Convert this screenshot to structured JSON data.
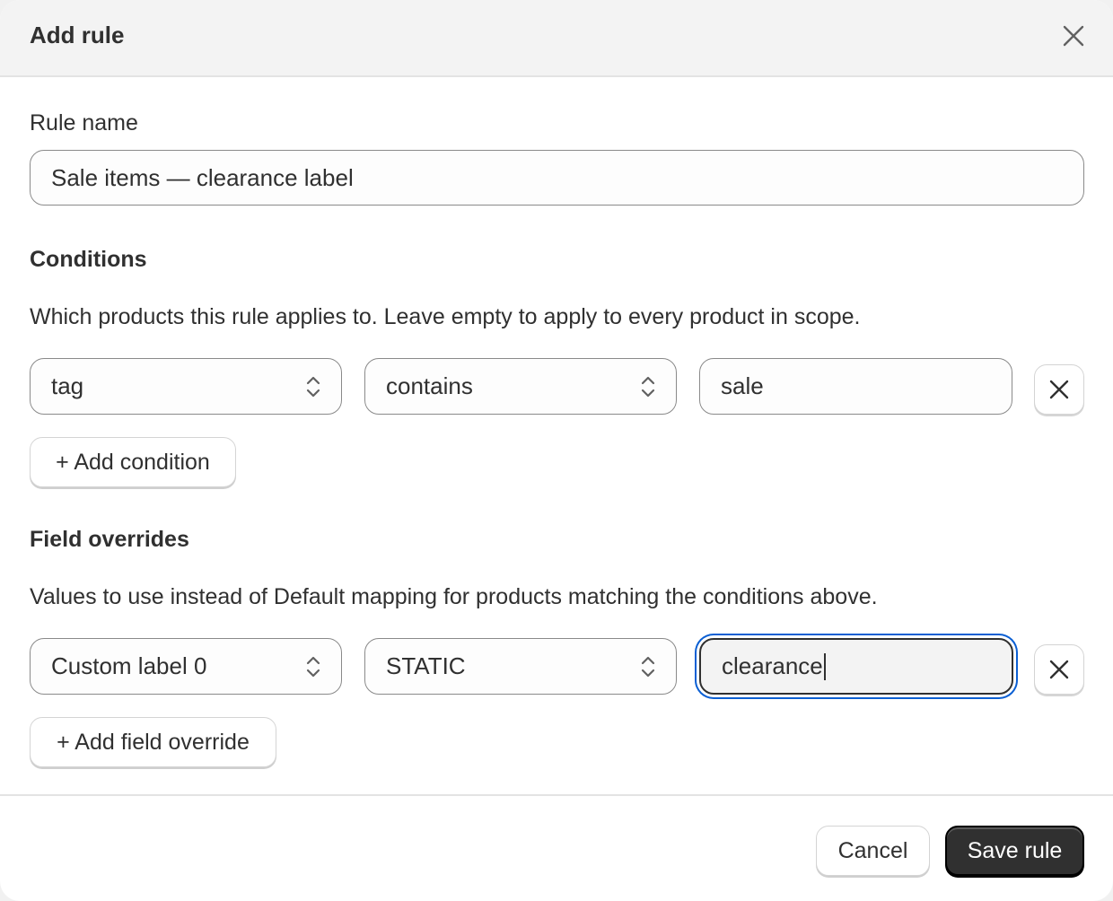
{
  "modal": {
    "title": "Add rule",
    "close_icon": "close-icon"
  },
  "rule_name": {
    "label": "Rule name",
    "value": "Sale items — clearance label"
  },
  "conditions": {
    "title": "Conditions",
    "help": "Which products this rule applies to. Leave empty to apply to every product in scope.",
    "rows": [
      {
        "field": "tag",
        "operator": "contains",
        "value": "sale"
      }
    ],
    "add_label": "+ Add condition"
  },
  "overrides": {
    "title": "Field overrides",
    "help": "Values to use instead of Default mapping for products matching the conditions above.",
    "rows": [
      {
        "field": "Custom label 0",
        "type": "STATIC",
        "value": "clearance"
      }
    ],
    "add_label": "+ Add field override"
  },
  "footer": {
    "cancel_label": "Cancel",
    "save_label": "Save rule"
  },
  "colors": {
    "focus_ring": "#0b5fd3",
    "primary": "#303030"
  }
}
